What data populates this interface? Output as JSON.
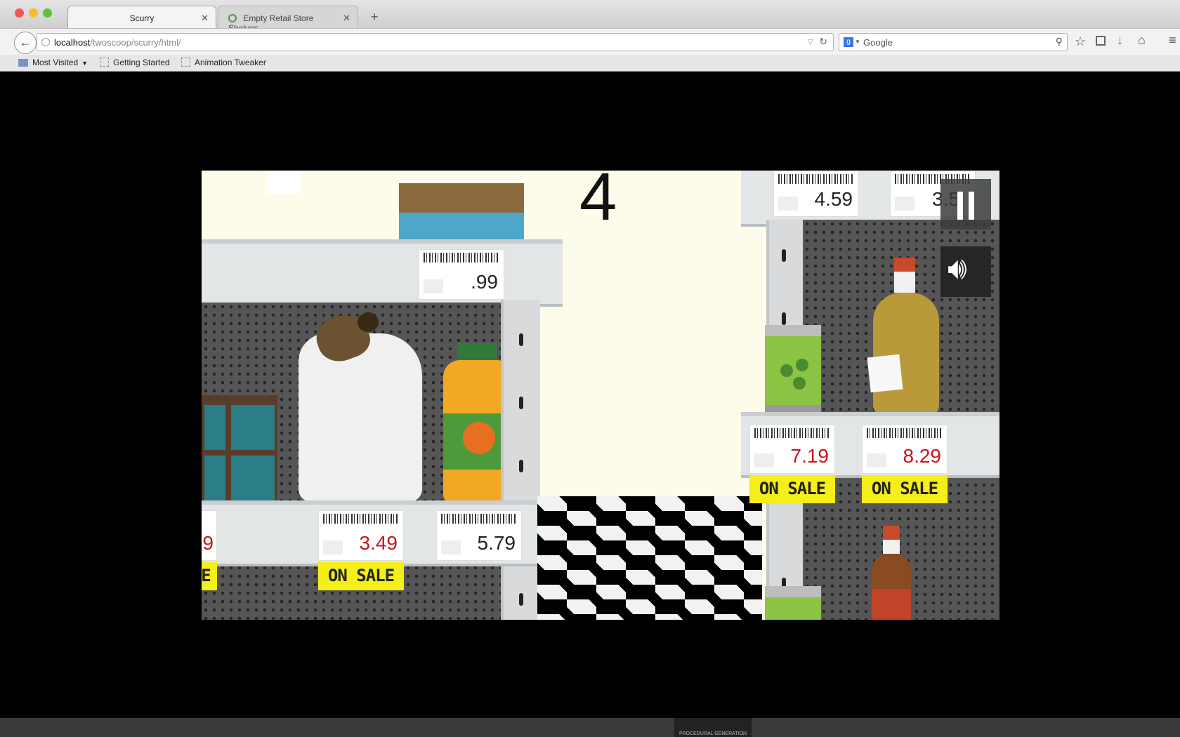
{
  "browser": {
    "tabs": [
      {
        "title": "Scurry",
        "active": true
      },
      {
        "title": "Empty Retail Store Shelves...",
        "active": false
      }
    ],
    "url_host": "localhost",
    "url_path": "/twoscoop/scurry/html/",
    "search_placeholder": "Google",
    "bookmarks": [
      "Most Visited",
      "Getting Started",
      "Animation Tweaker"
    ]
  },
  "game": {
    "score": "4",
    "price_tags": {
      "top_shelf_left": ".99",
      "top_right_1": "4.59",
      "top_right_2": "3.5",
      "bottom_left_partial": "9",
      "bottom_mid": "3.49",
      "bottom_right": "5.79",
      "right_can": "7.19",
      "right_bottle": "8.29"
    },
    "sale_label": "ON SALE",
    "sale_label_partial": "E",
    "controls": {
      "pause_icon": "pause-icon",
      "sound_icon": "speaker-icon"
    },
    "colors": {
      "sale_yellow": "#f4ef18",
      "sale_price_red": "#c8141b",
      "background_cream": "#fdfbe9"
    }
  },
  "taskbar": {
    "thumbnail_label": "PROCEDURAL GENERATION"
  }
}
